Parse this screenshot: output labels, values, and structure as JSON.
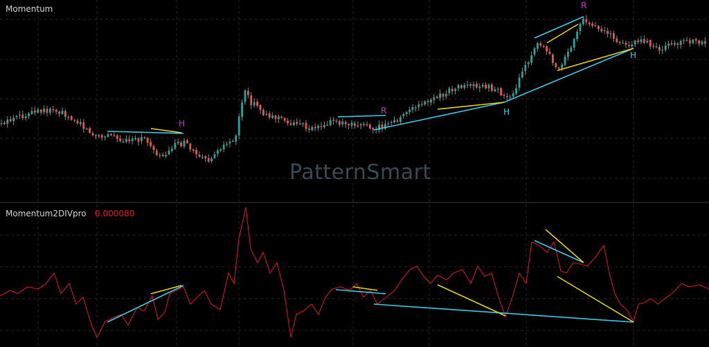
{
  "top_pane": {
    "title": "Momentum"
  },
  "bottom_pane": {
    "title": "Momentum2DIVpro",
    "value": "0.000080"
  },
  "watermark": "PatternSmart",
  "colors": {
    "background": "#000000",
    "grid": "#262626",
    "separator": "#3a3a3a",
    "up_candle": "#26a69a",
    "down_candle": "#ef5350",
    "wick": "#8a8a8a",
    "indicator_line": "#d0161a",
    "cyan_line": "#3ecbe6",
    "yellow_line": "#e6d51f",
    "marker_magenta": "#cc33cc",
    "marker_cyan": "#3ecbe6"
  },
  "chart_data": [
    {
      "type": "candlestick",
      "title": "Momentum",
      "annotations": [
        {
          "text": "H",
          "color": "magenta"
        },
        {
          "text": "R",
          "color": "magenta"
        },
        {
          "text": "H",
          "color": "cyan"
        },
        {
          "text": "R",
          "color": "magenta"
        },
        {
          "text": "H",
          "color": "cyan"
        }
      ],
      "trendlines": [
        {
          "color": "cyan"
        },
        {
          "color": "yellow"
        },
        {
          "color": "cyan"
        },
        {
          "color": "cyan"
        },
        {
          "color": "yellow"
        },
        {
          "color": "cyan"
        },
        {
          "color": "yellow"
        },
        {
          "color": "cyan"
        },
        {
          "color": "yellow"
        }
      ]
    },
    {
      "type": "line",
      "title": "Momentum2DIVpro",
      "series": [
        {
          "name": "Momentum2DIVpro",
          "last_value": 8e-05
        }
      ],
      "trendlines": [
        {
          "color": "cyan"
        },
        {
          "color": "yellow"
        },
        {
          "color": "cyan"
        },
        {
          "color": "yellow"
        },
        {
          "color": "cyan"
        },
        {
          "color": "yellow"
        },
        {
          "color": "cyan"
        },
        {
          "color": "yellow"
        },
        {
          "color": "yellow"
        }
      ]
    }
  ]
}
